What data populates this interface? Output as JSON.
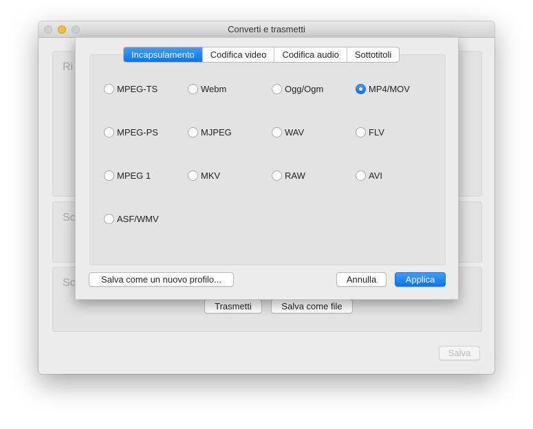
{
  "window": {
    "title": "Converti e trasmetti"
  },
  "background": {
    "panel_labels": [
      "Ri",
      "Sc",
      "Sc"
    ],
    "trasmetti": "Trasmetti",
    "salva_come_file": "Salva come file",
    "salva": "Salva"
  },
  "sheet": {
    "tabs": [
      {
        "label": "Incapsulamento",
        "active": true
      },
      {
        "label": "Codifica video"
      },
      {
        "label": "Codifica audio"
      },
      {
        "label": "Sottotitoli"
      }
    ],
    "options": [
      {
        "label": "MPEG-TS",
        "selected": false
      },
      {
        "label": "Webm",
        "selected": false
      },
      {
        "label": "Ogg/Ogm",
        "selected": false
      },
      {
        "label": "MP4/MOV",
        "selected": true
      },
      {
        "label": "MPEG-PS",
        "selected": false
      },
      {
        "label": "MJPEG",
        "selected": false
      },
      {
        "label": "WAV",
        "selected": false
      },
      {
        "label": "FLV",
        "selected": false
      },
      {
        "label": "MPEG 1",
        "selected": false
      },
      {
        "label": "MKV",
        "selected": false
      },
      {
        "label": "RAW",
        "selected": false
      },
      {
        "label": "AVI",
        "selected": false
      },
      {
        "label": "ASF/WMV",
        "selected": false
      }
    ],
    "save_profile": "Salva come un nuovo profilo...",
    "cancel": "Annulla",
    "apply": "Applica"
  }
}
